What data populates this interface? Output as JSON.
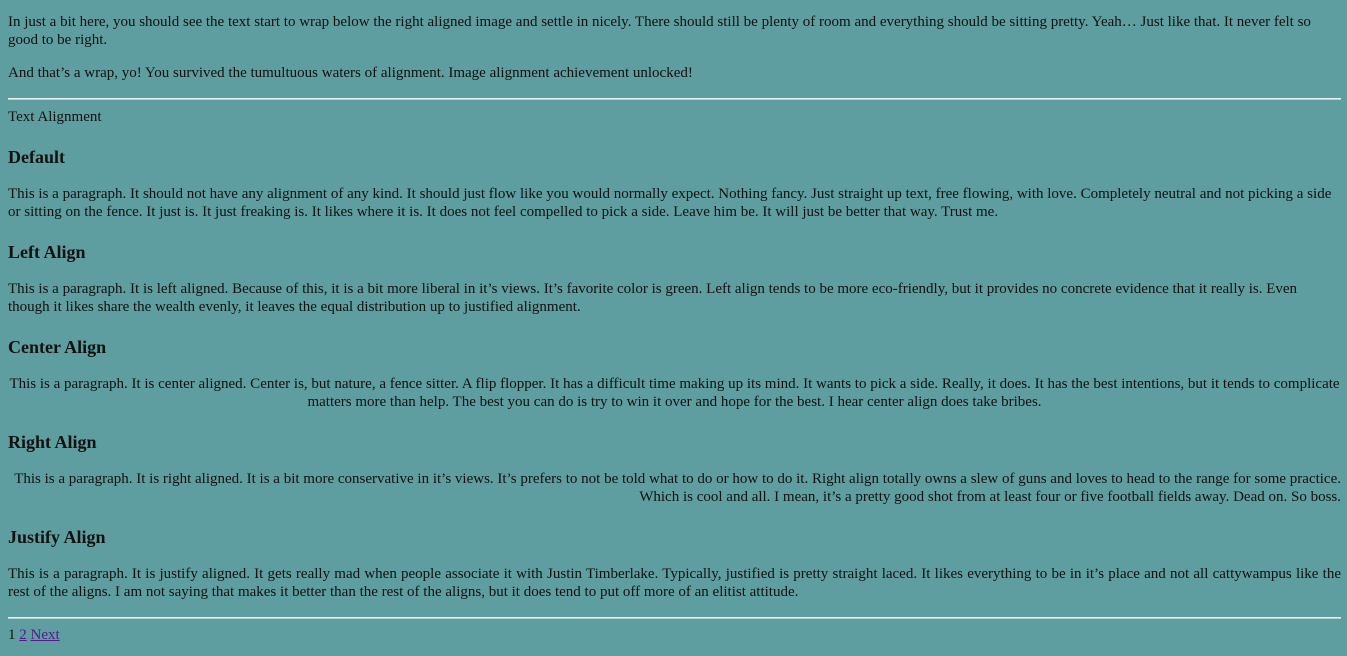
{
  "intro": {
    "paragraph1": "In just a bit here, you should see the text start to wrap below the right aligned image and settle in nicely. There should still be plenty of room and everything should be sitting pretty. Yeah… Just like that. It never felt so good to be right.",
    "paragraph2": "And that’s a wrap, yo! You survived the tumultuous waters of alignment. Image alignment achievement unlocked!"
  },
  "section_label": "Text Alignment",
  "sections": [
    {
      "heading": "Default",
      "text": "This is a paragraph. It should not have any alignment of any kind. It should just flow like you would normally expect. Nothing fancy. Just straight up text, free flowing, with love. Completely neutral and not picking a side or sitting on the fence. It just is. It just freaking is. It likes where it is. It does not feel compelled to pick a side. Leave him be. It will just be better that way. Trust me."
    },
    {
      "heading": "Left Align",
      "text": "This is a paragraph. It is left aligned. Because of this, it is a bit more liberal in it’s views. It’s favorite color is green. Left align tends to be more eco-friendly, but it provides no concrete evidence that it really is. Even though it likes share the wealth evenly, it leaves the equal distribution up to justified alignment."
    },
    {
      "heading": "Center Align",
      "text": "This is a paragraph. It is center aligned. Center is, but nature, a fence sitter. A flip flopper. It has a difficult time making up its mind. It wants to pick a side. Really, it does. It has the best intentions, but it tends to complicate matters more than help. The best you can do is try to win it over and hope for the best. I hear center align does take bribes."
    },
    {
      "heading": "Right Align",
      "text": "This is a paragraph. It is right aligned. It is a bit more conservative in it’s views. It’s prefers to not be told what to do or how to do it. Right align totally owns a slew of guns and loves to head to the range for some practice. Which is cool and all. I mean, it’s a pretty good shot from at least four or five football fields away. Dead on. So boss."
    },
    {
      "heading": "Justify Align",
      "text": "This is a paragraph. It is justify aligned. It gets really mad when people associate it with Justin Timberlake. Typically, justified is pretty straight laced. It likes everything to be in it’s place and not all cattywampus like the rest of the aligns. I am not saying that makes it better than the rest of the aligns, but it does tend to put off more of an elitist attitude."
    }
  ],
  "pagination": {
    "current": "1",
    "page2": "2",
    "next": "Next"
  },
  "colors": {
    "background": "#5f9ea0",
    "link": "#551a8b"
  }
}
